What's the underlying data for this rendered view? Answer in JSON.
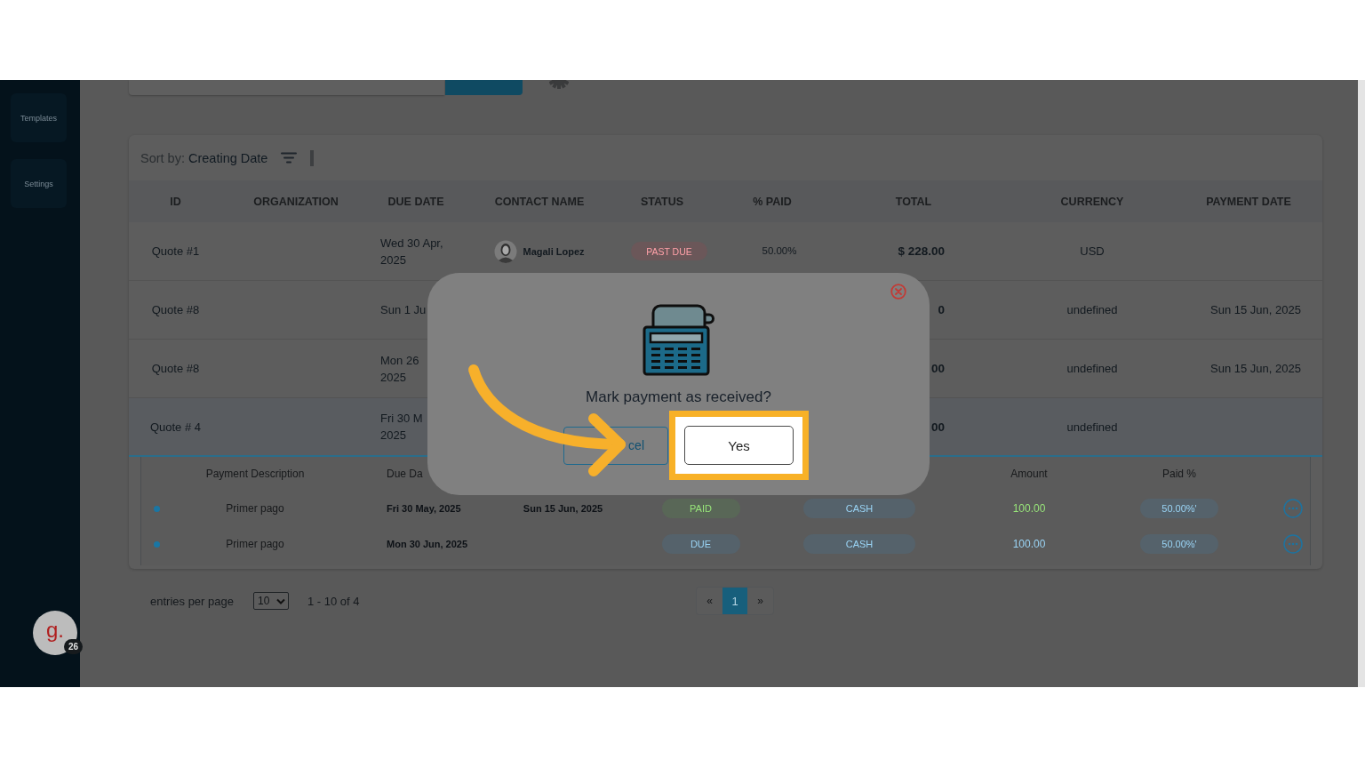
{
  "sidebar": {
    "items": [
      {
        "label": "Templates"
      },
      {
        "label": "Settings"
      }
    ],
    "user": {
      "initial": "g.",
      "badge": "26"
    }
  },
  "sort": {
    "label": "Sort by:",
    "value": "Creating Date"
  },
  "table": {
    "columns": [
      "ID",
      "ORGANIZATION",
      "DUE DATE",
      "CONTACT NAME",
      "STATUS",
      "% PAID",
      "TOTAL",
      "CURRENCY",
      "PAYMENT DATE"
    ],
    "rows": [
      {
        "id": "Quote #1",
        "due_date": [
          "Wed 30 Apr,",
          "2025"
        ],
        "contact": "Magali Lopez",
        "status": {
          "label": "PAST DUE",
          "kind": "past_due"
        },
        "paid": "50.00%",
        "total": "$ 228.00",
        "currency": "USD",
        "expanded": false
      },
      {
        "id": "Quote #8",
        "due_date": [
          "Sun 1 Ju"
        ],
        "total": "0",
        "currency": "undefined",
        "payment_date": "Sun 15 Jun, 2025",
        "expanded": false
      },
      {
        "id": "Quote #8",
        "due_date": [
          "Mon 26",
          "2025"
        ],
        "total": "00",
        "currency": "undefined",
        "payment_date": "Sun 15 Jun, 2025",
        "expanded": false
      },
      {
        "id": "Quote # 4",
        "due_date": [
          "Fri 30 M",
          "2025"
        ],
        "total": "00",
        "currency": "undefined",
        "expanded": true
      }
    ]
  },
  "payments": {
    "headings": {
      "description": "Payment Description",
      "due_date": "Due Da",
      "amount": "Amount",
      "paid_percent": "Paid %"
    },
    "rows": [
      {
        "description": "Primer pago",
        "due_date": "Fri 30 May, 2025",
        "payment_date": "Sun 15 Jun, 2025",
        "status": {
          "label": "PAID",
          "kind": "paid"
        },
        "method": "CASH",
        "amount": "100.00",
        "paid_percent": "50.00%'"
      },
      {
        "description": "Primer pago",
        "due_date": "Mon 30 Jun, 2025",
        "status": {
          "label": "DUE",
          "kind": "due"
        },
        "method": "CASH",
        "amount": "100.00",
        "paid_percent": "50.00%'"
      }
    ]
  },
  "pagination": {
    "entries_label": "entries per page",
    "per_page": "10",
    "range": "1 - 10 of 4",
    "first": "«",
    "pages": [
      {
        "label": "1",
        "selected": true
      }
    ],
    "last": "»"
  },
  "dialog": {
    "title": "Mark payment as received?",
    "buttons": [
      {
        "label": "cel",
        "kind": "secondary",
        "highlighted": false
      },
      {
        "label": "Yes",
        "kind": "primary",
        "highlighted": true
      }
    ]
  }
}
